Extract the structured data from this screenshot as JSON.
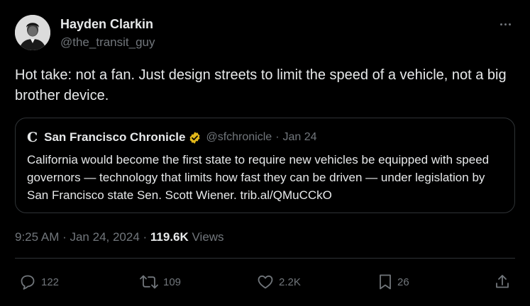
{
  "author": {
    "name": "Hayden Clarkin",
    "handle": "@the_transit_guy"
  },
  "tweet": {
    "text": "Hot take: not a fan. Just design streets to limit the speed of a vehicle, not a big brother device."
  },
  "quoted": {
    "logo_glyph": "C",
    "name": "San Francisco Chronicle",
    "verified_badge": "gold-verified-icon",
    "handle": "@sfchronicle",
    "separator": "·",
    "date": "Jan 24",
    "text": "California would become the first state to require new vehicles be equipped with speed governors — technology that limits how fast they can be driven — under legislation by San Francisco state Sen. Scott Wiener. trib.al/QMuCCkO"
  },
  "meta": {
    "timestamp": "9:25 AM · Jan 24, 2024 · ",
    "views_count": "119.6K",
    "views_label": " Views"
  },
  "actions": {
    "replies": "122",
    "reposts": "109",
    "likes": "2.2K",
    "bookmarks": "26"
  },
  "colors": {
    "background": "#000000",
    "text": "#e7e9ea",
    "secondary": "#71767b",
    "border": "#2f3336",
    "verified_gold": "#e2b719"
  }
}
